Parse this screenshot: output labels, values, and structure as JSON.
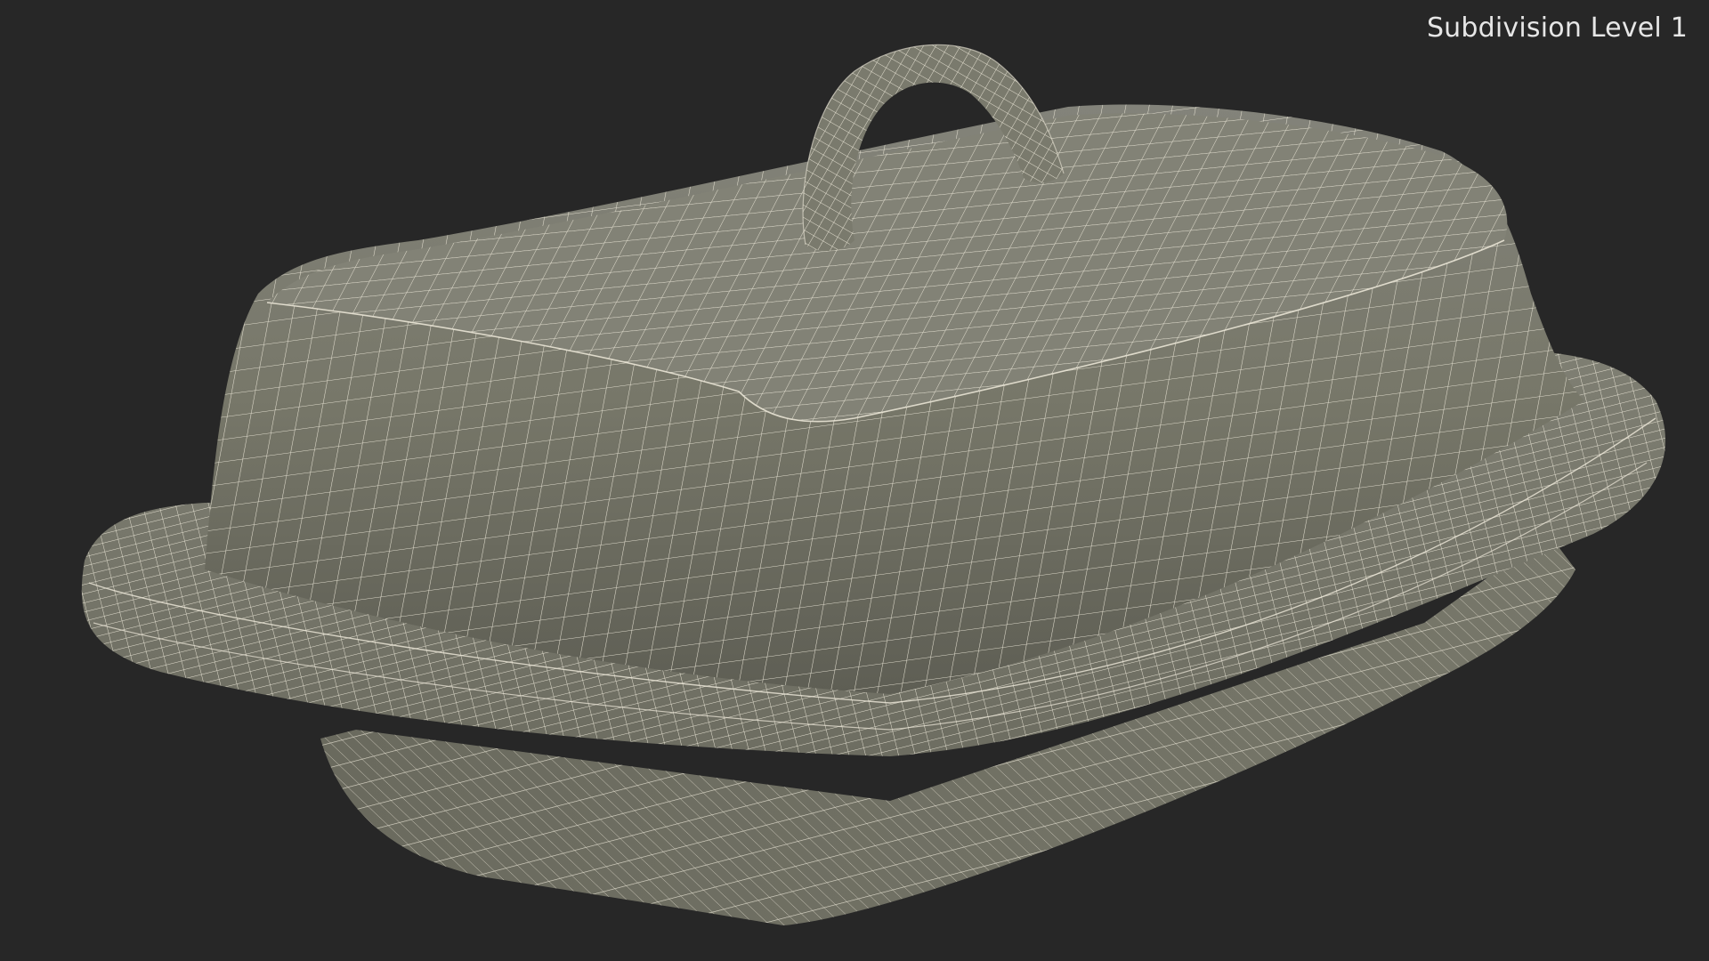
{
  "viewport": {
    "label": "Subdivision Level 1"
  },
  "colors": {
    "background": "#272727",
    "surface": "#7b7b6e",
    "surface_shadow": "#5f5f55",
    "wire": "#efeadb"
  },
  "model": {
    "subject": "butter-dish-wireframe",
    "subdivision_level": 1
  }
}
